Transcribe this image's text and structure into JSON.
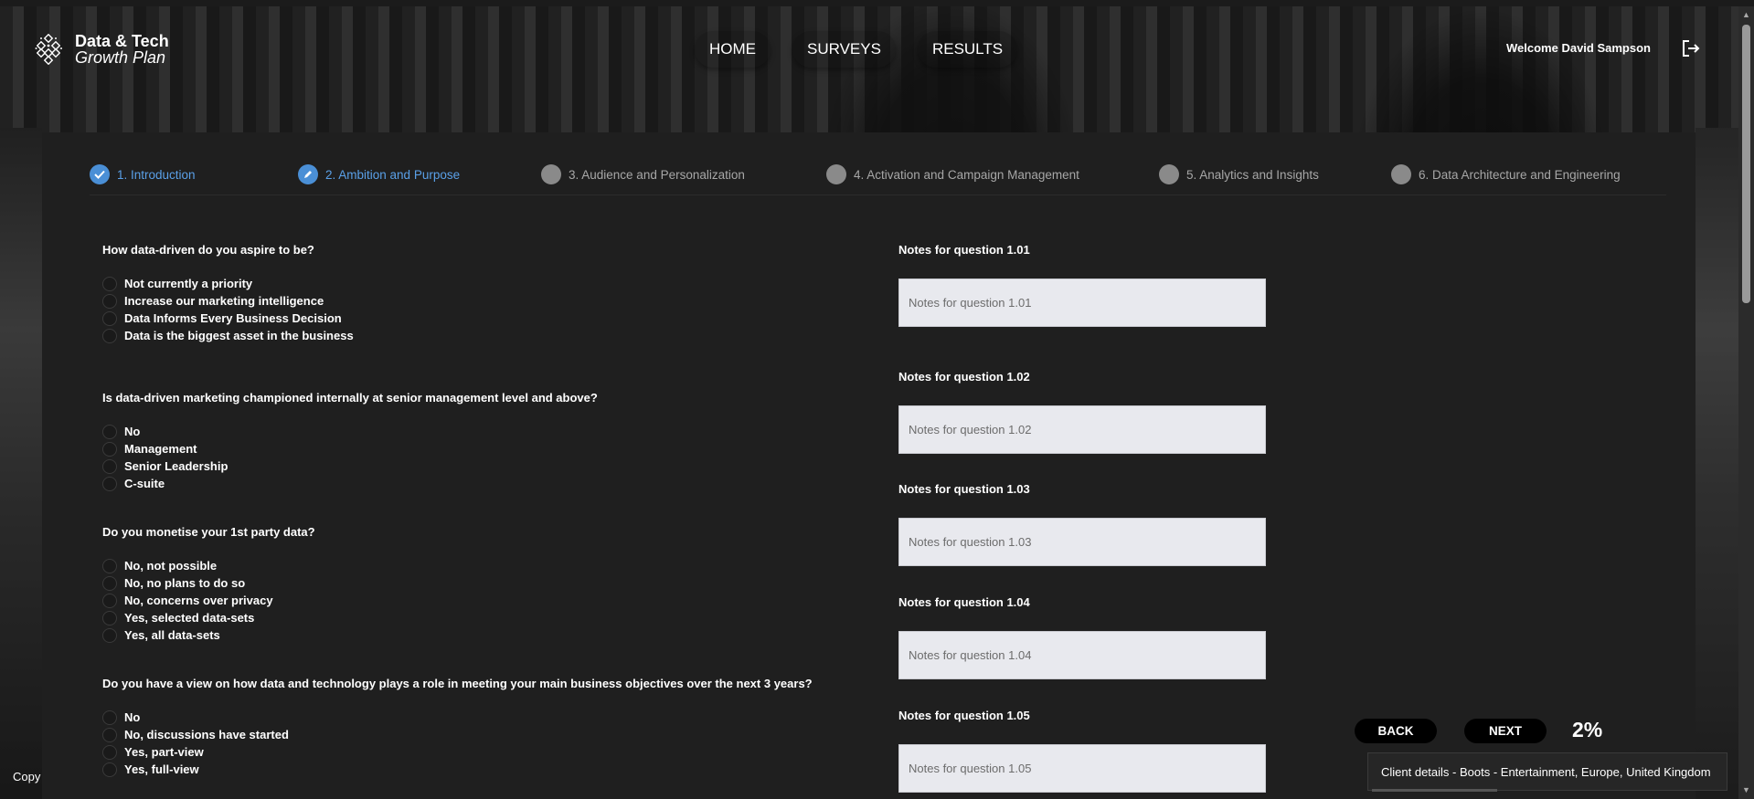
{
  "app": {
    "logo_title": "Data & Tech",
    "logo_subtitle": "Growth Plan"
  },
  "nav": {
    "items": [
      {
        "label": "HOME"
      },
      {
        "label": "SURVEYS"
      },
      {
        "label": "RESULTS"
      }
    ]
  },
  "user": {
    "welcome": "Welcome David Sampson"
  },
  "stepper": {
    "steps": [
      {
        "label": "1. Introduction",
        "state": "completed",
        "icon": "check-icon"
      },
      {
        "label": "2. Ambition and Purpose",
        "state": "active",
        "icon": "pencil-icon"
      },
      {
        "label": "3. Audience and Personalization",
        "state": "pending"
      },
      {
        "label": "4. Activation and Campaign Management",
        "state": "pending"
      },
      {
        "label": "5. Analytics and Insights",
        "state": "pending"
      },
      {
        "label": "6. Data Architecture and Engineering",
        "state": "pending"
      }
    ]
  },
  "questions": [
    {
      "text": "How data-driven do you aspire to be?",
      "options": [
        "Not currently a priority",
        "Increase our marketing intelligence",
        "Data Informs Every Business Decision",
        "Data is the biggest asset in the business"
      ]
    },
    {
      "text": "Is data-driven marketing championed internally at senior management level and above?",
      "options": [
        "No",
        "Management",
        "Senior Leadership",
        "C-suite"
      ]
    },
    {
      "text": "Do you monetise your 1st party data?",
      "options": [
        "No, not possible",
        "No, no plans to do so",
        "No, concerns over privacy",
        "Yes, selected data-sets",
        "Yes, all data-sets"
      ]
    },
    {
      "text": "Do you have a view on how data and technology plays a role in meeting your main business objectives over the next 3 years?",
      "options": [
        "No",
        "No, discussions have started",
        "Yes, part-view",
        "Yes, full-view"
      ]
    }
  ],
  "notes": [
    {
      "label": "Notes for question 1.01",
      "placeholder": "Notes for question 1.01",
      "value": ""
    },
    {
      "label": "Notes for question 1.02",
      "placeholder": "Notes for question 1.02",
      "value": ""
    },
    {
      "label": "Notes for question 1.03",
      "placeholder": "Notes for question 1.03",
      "value": ""
    },
    {
      "label": "Notes for question 1.04",
      "placeholder": "Notes for question 1.04",
      "value": ""
    },
    {
      "label": "Notes for question 1.05",
      "placeholder": "Notes for question 1.05",
      "value": ""
    }
  ],
  "controls": {
    "back_label": "BACK",
    "next_label": "NEXT",
    "progress": "2%"
  },
  "client": {
    "details": "Client details - Boots - Entertainment, Europe, United Kingdom"
  },
  "footer": {
    "copy_text": "Copy"
  },
  "colors": {
    "accent": "#4a8fd6",
    "panel": "#1f1f1f",
    "input_bg": "#e8e9ee"
  }
}
